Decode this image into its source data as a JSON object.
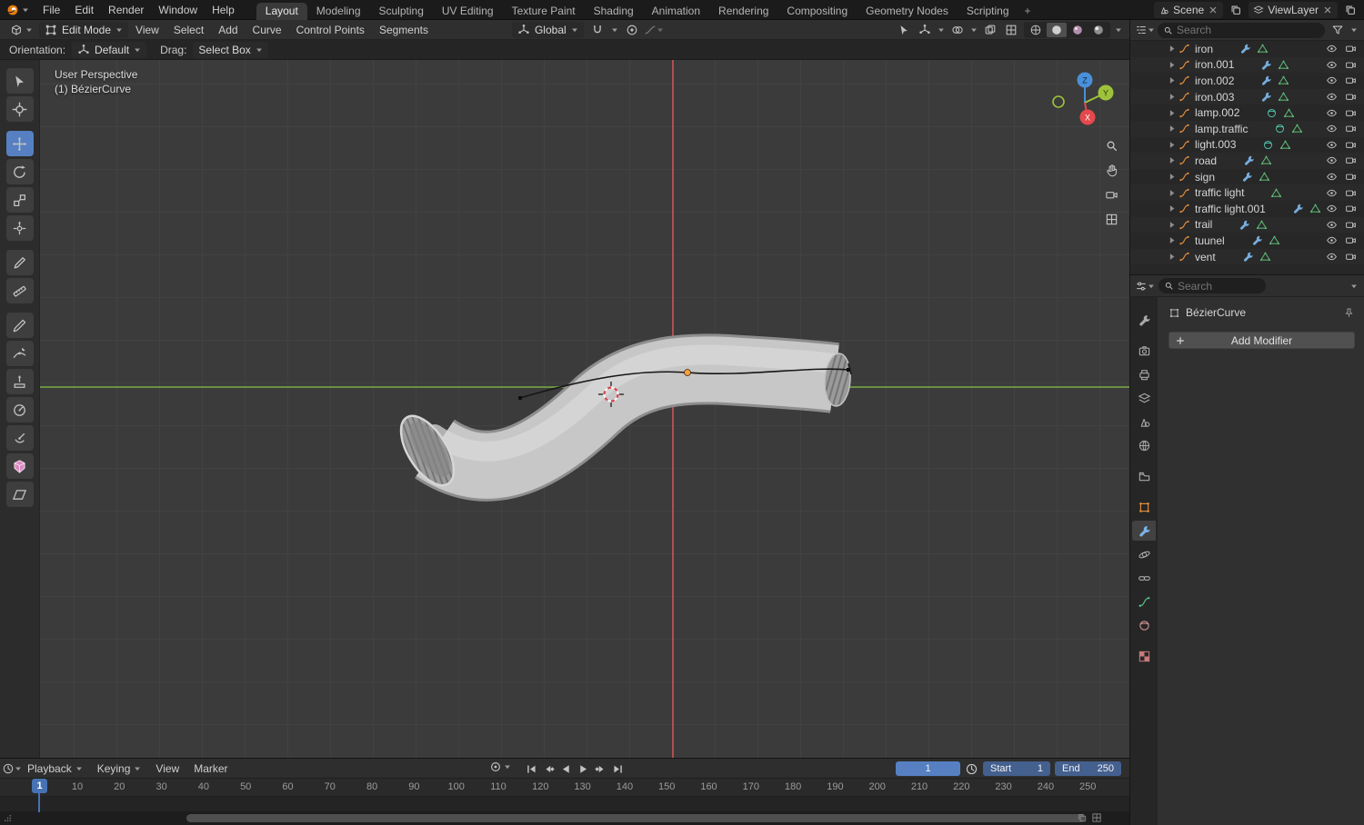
{
  "topbar": {
    "menus": [
      "File",
      "Edit",
      "Render",
      "Window",
      "Help"
    ],
    "tabs": [
      "Layout",
      "Modeling",
      "Sculpting",
      "UV Editing",
      "Texture Paint",
      "Shading",
      "Animation",
      "Rendering",
      "Compositing",
      "Geometry Nodes",
      "Scripting"
    ],
    "active_tab": "Layout",
    "add_workspace": "+",
    "scene_label": "Scene",
    "viewlayer_label": "ViewLayer"
  },
  "viewport_header": {
    "mode": "Edit Mode",
    "menus": [
      "View",
      "Select",
      "Add",
      "Curve",
      "Control Points",
      "Segments"
    ],
    "orientation": "Global"
  },
  "tool_settings": {
    "orientation_label": "Orientation:",
    "orientation_value": "Default",
    "drag_label": "Drag:",
    "drag_value": "Select Box"
  },
  "viewport": {
    "view_label": "User Perspective",
    "object_label": "(1) BézierCurve",
    "axis_z": "Z",
    "axis_y": "Y",
    "axis_x": "X"
  },
  "toolbar": {
    "tools": [
      {
        "name": "select-box",
        "active": false
      },
      {
        "name": "cursor",
        "active": false
      },
      {
        "name": "move",
        "active": true
      },
      {
        "name": "rotate",
        "active": false
      },
      {
        "name": "scale",
        "active": false
      },
      {
        "name": "transform",
        "active": false
      },
      {
        "name": "annotate",
        "active": false
      },
      {
        "name": "measure",
        "active": false
      },
      {
        "name": "draw",
        "active": false
      },
      {
        "name": "curve-pen",
        "active": false
      },
      {
        "name": "extrude",
        "active": false
      },
      {
        "name": "radius",
        "active": false
      },
      {
        "name": "tilt",
        "active": false
      },
      {
        "name": "randomize",
        "active": false
      },
      {
        "name": "shear",
        "active": false
      }
    ]
  },
  "outliner": {
    "search_placeholder": "Search",
    "items": [
      {
        "name": "iron",
        "icons": [
          "modifier",
          "mesh"
        ]
      },
      {
        "name": "iron.001",
        "icons": [
          "modifier",
          "mesh"
        ]
      },
      {
        "name": "iron.002",
        "icons": [
          "modifier",
          "mesh"
        ]
      },
      {
        "name": "iron.003",
        "icons": [
          "modifier",
          "mesh"
        ]
      },
      {
        "name": "lamp.002",
        "icons": [
          "material",
          "mesh"
        ]
      },
      {
        "name": "lamp.traffic",
        "icons": [
          "material",
          "mesh"
        ]
      },
      {
        "name": "light.003",
        "icons": [
          "material",
          "mesh"
        ]
      },
      {
        "name": "road",
        "icons": [
          "modifier",
          "mesh"
        ]
      },
      {
        "name": "sign",
        "icons": [
          "modifier",
          "mesh"
        ]
      },
      {
        "name": "traffic light",
        "icons": [
          "mesh"
        ]
      },
      {
        "name": "traffic light.001",
        "icons": [
          "modifier",
          "mesh"
        ]
      },
      {
        "name": "trail",
        "icons": [
          "modifier",
          "mesh"
        ]
      },
      {
        "name": "tuunel",
        "icons": [
          "modifier",
          "mesh"
        ]
      },
      {
        "name": "vent",
        "icons": [
          "modifier",
          "mesh"
        ]
      }
    ]
  },
  "properties": {
    "search_placeholder": "Search",
    "breadcrumb": "BézierCurve",
    "add_modifier_label": "Add Modifier",
    "tabs": [
      {
        "name": "tool",
        "active": false
      },
      {
        "name": "render",
        "active": false
      },
      {
        "name": "output",
        "active": false
      },
      {
        "name": "view-layer",
        "active": false
      },
      {
        "name": "scene",
        "active": false
      },
      {
        "name": "world",
        "active": false
      },
      {
        "name": "collection",
        "active": false
      },
      {
        "name": "object",
        "active": false,
        "color": "#e8913c"
      },
      {
        "name": "modifiers",
        "active": true,
        "color": "#7db1e8"
      },
      {
        "name": "physics",
        "active": false
      },
      {
        "name": "constraints",
        "active": false
      },
      {
        "name": "object-data",
        "active": false,
        "color": "#58c08d"
      },
      {
        "name": "material",
        "active": false,
        "color": "#c98f8f"
      },
      {
        "name": "texture",
        "active": false,
        "color": "#c97b7b"
      }
    ]
  },
  "timeline": {
    "menus": [
      "Playback",
      "Keying",
      "View",
      "Marker"
    ],
    "transport": [
      "jump-start",
      "prev-keyframe",
      "play-reverse",
      "play",
      "next-keyframe",
      "jump-end"
    ],
    "current_frame": "1",
    "start_label": "Start",
    "start_value": "1",
    "end_label": "End",
    "end_value": "250",
    "playhead_label": "1",
    "ticks": [
      "10",
      "20",
      "30",
      "40",
      "50",
      "60",
      "70",
      "80",
      "90",
      "100",
      "110",
      "120",
      "130",
      "140",
      "150",
      "160",
      "170",
      "180",
      "190",
      "200",
      "210",
      "220",
      "230",
      "240",
      "250"
    ]
  },
  "colors": {
    "accent": "#4772b3",
    "axis_x": "#e5494d",
    "axis_y": "#9ec33b",
    "axis_z": "#4a90d9",
    "object_orange": "#e8913c"
  }
}
